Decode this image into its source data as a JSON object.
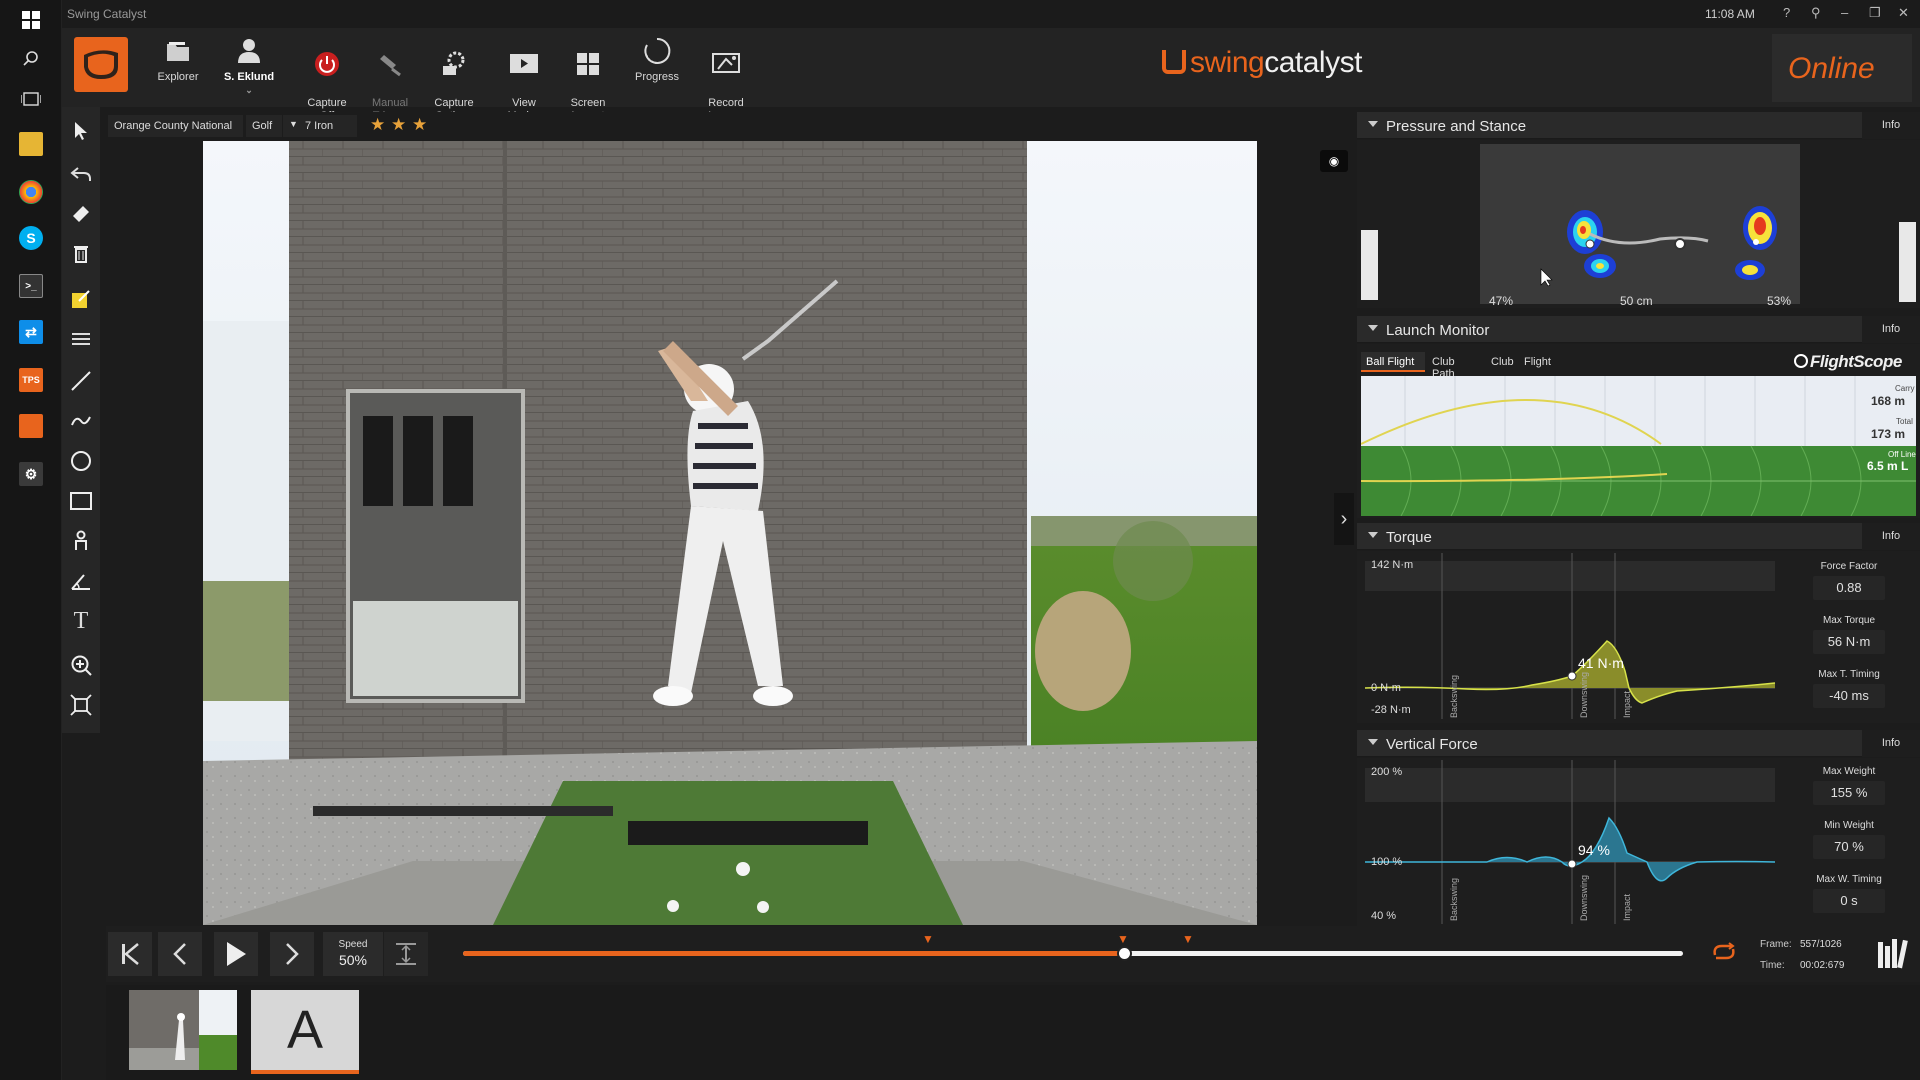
{
  "app": {
    "window_title": "Swing Catalyst",
    "clock": "11:08 AM",
    "window_controls": [
      "?",
      "⚲",
      "–",
      "❐",
      "✕"
    ]
  },
  "os_taskbar": {
    "icons": [
      "windows-icon",
      "search-icon",
      "task-view-icon",
      "file-explorer-icon",
      "chrome-icon",
      "skype-icon",
      "terminal-icon",
      "teamviewer-icon",
      "tps-icon",
      "swingcatalyst-app-icon",
      "settings-icon"
    ],
    "tps_label": "TPS"
  },
  "ribbon": {
    "buttons": [
      {
        "label": "Explorer",
        "icon": "folder-icon"
      },
      {
        "label": "S. Eklund",
        "icon": "user-icon"
      },
      {
        "label": "Capture\nOff",
        "icon": "power-icon"
      },
      {
        "label": "Manual\nTrigger",
        "icon": "trigger-icon"
      },
      {
        "label": "Capture\nOptions",
        "icon": "gear-camera-icon"
      },
      {
        "label": "View\nModes",
        "icon": "view-modes-icon"
      },
      {
        "label": "Screen\nLayout",
        "icon": "grid-icon"
      },
      {
        "label": "Progress",
        "icon": "progress-icon"
      },
      {
        "label": "Record\nLesson",
        "icon": "record-lesson-icon"
      }
    ],
    "brand_prefix": "swing",
    "brand_suffix": "catalyst",
    "online_label": "Online",
    "colors": {
      "accent": "#e8641d"
    }
  },
  "info_strip": {
    "location": "Orange County National",
    "sport": "Golf",
    "club": "7 Iron",
    "rating": 3,
    "star_glyph": "★"
  },
  "panels": {
    "pressure": {
      "title": "Pressure and Stance",
      "info": "Info",
      "left_pct": "47%",
      "stance_width": "50 cm",
      "right_pct": "53%"
    },
    "launch": {
      "title": "Launch Monitor",
      "info": "Info",
      "tabs": [
        "Ball Flight",
        "Club Path",
        "Club",
        "Flight"
      ],
      "provider": "FlightScope",
      "carry_label": "Carry",
      "carry_value": "168 m",
      "total_label": "Total",
      "total_value": "173 m",
      "offline_label": "Off Line",
      "offline_value": "6.5 m L"
    },
    "torque": {
      "title": "Torque",
      "info": "Info",
      "y_top": "142 N·m",
      "y_zero": "0 N·m",
      "y_bottom": "-28 N·m",
      "marker_value": "41 N·m",
      "phase_labels": [
        "Backswing",
        "Downswing",
        "Impact"
      ],
      "stats": [
        {
          "label": "Force Factor",
          "value": "0.88"
        },
        {
          "label": "Max Torque",
          "value": "56 N·m"
        },
        {
          "label": "Max T. Timing",
          "value": "-40 ms"
        }
      ]
    },
    "vertical": {
      "title": "Vertical Force",
      "info": "Info",
      "y_top": "200 %",
      "y_mid": "100 %",
      "y_bottom": "40 %",
      "marker_value": "94 %",
      "phase_labels": [
        "Backswing",
        "Downswing",
        "Impact"
      ],
      "stats": [
        {
          "label": "Max Weight",
          "value": "155 %"
        },
        {
          "label": "Min Weight",
          "value": "70 %"
        },
        {
          "label": "Max W. Timing",
          "value": "0 s"
        }
      ]
    }
  },
  "playback": {
    "speed_label": "Speed",
    "speed_value": "50%",
    "frame_label": "Frame:",
    "frame_value": "557/1026",
    "time_label": "Time:",
    "time_value": "00:02:679",
    "progress": 0.543
  },
  "thumbnails": {
    "second_letter": "A"
  }
}
